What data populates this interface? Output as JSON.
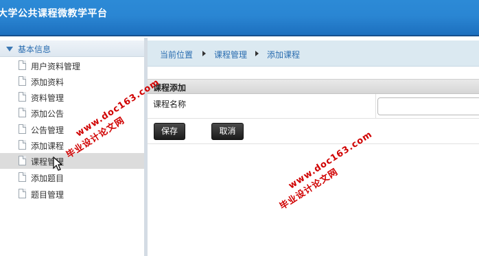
{
  "header": {
    "title": "大学公共课程微教学平台"
  },
  "sidebar": {
    "section_label": "基本信息",
    "items": [
      {
        "label": "用户资料管理"
      },
      {
        "label": "添加资料"
      },
      {
        "label": "资料管理"
      },
      {
        "label": "添加公告"
      },
      {
        "label": "公告管理"
      },
      {
        "label": "添加课程"
      },
      {
        "label": "课程管理"
      },
      {
        "label": "添加题目"
      },
      {
        "label": "题目管理"
      }
    ],
    "active_item": "课程管理"
  },
  "breadcrumb": {
    "current_label": "当前位置",
    "items": [
      "课程管理",
      "添加课程"
    ]
  },
  "form": {
    "title": "课程添加",
    "fields": [
      {
        "label": "课程名称",
        "value": ""
      }
    ],
    "save_label": "保存",
    "cancel_label": "取消"
  },
  "watermarks": [
    {
      "line1": "毕业设计论文网",
      "line2": "www.doc163.com"
    },
    {
      "line1": "毕业设计论文网",
      "line2": "www.doc163.com"
    }
  ],
  "colors": {
    "header": "#2a86d3",
    "breadcrumb_bg": "#dbe9f1",
    "link": "#2a6db0",
    "button": "#2b2b2b",
    "watermark": "#d00000"
  },
  "icons": {
    "section_toggle": "triangle-down-icon",
    "nav_item": "document-icon"
  }
}
